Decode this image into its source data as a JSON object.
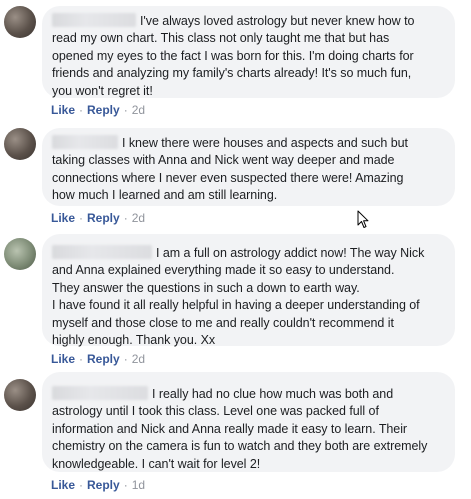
{
  "comments": [
    {
      "lines": [
        "I've always loved astrology but never knew how to",
        "read my own chart. This class not only taught me that but has",
        "opened my eyes to the fact I was born for this. I'm doing charts for",
        "friends and analyzing my family's charts already! It's so much fun,",
        "you won't regret it!"
      ],
      "like": "Like",
      "reply": "Reply",
      "time": "2d"
    },
    {
      "lines": [
        "I knew there were houses and aspects and such but",
        "taking classes with Anna and Nick went way deeper and made",
        "connections where I never even suspected there were! Amazing",
        "how much I learned and am still learning."
      ],
      "like": "Like",
      "reply": "Reply",
      "time": "2d"
    },
    {
      "lines": [
        "I am a full on astrology addict now! The way Nick",
        "and Anna explained everything made it so easy to understand.",
        "They answer the questions in such a down to earth way.",
        "I have found it all really helpful in having a deeper understanding of",
        "myself and those close to me and really couldn't recommend it",
        "highly enough. Thank you. Xx"
      ],
      "like": "Like",
      "reply": "Reply",
      "time": "2d"
    },
    {
      "lines": [
        "I really had no clue how much was both and",
        "astrology until I took this class. Level one was packed full of",
        "information and Nick and Anna really made it easy to learn. Their",
        "chemistry on the camera is fun to watch and they both are extremely",
        "knowledgeable. I can't wait for level 2!"
      ],
      "like": "Like",
      "reply": "Reply",
      "time": "1d"
    }
  ],
  "separator": "·",
  "colors": {
    "bubble": "#f2f3f5",
    "link": "#385898",
    "meta": "#90949c",
    "text": "#1c1e21"
  }
}
